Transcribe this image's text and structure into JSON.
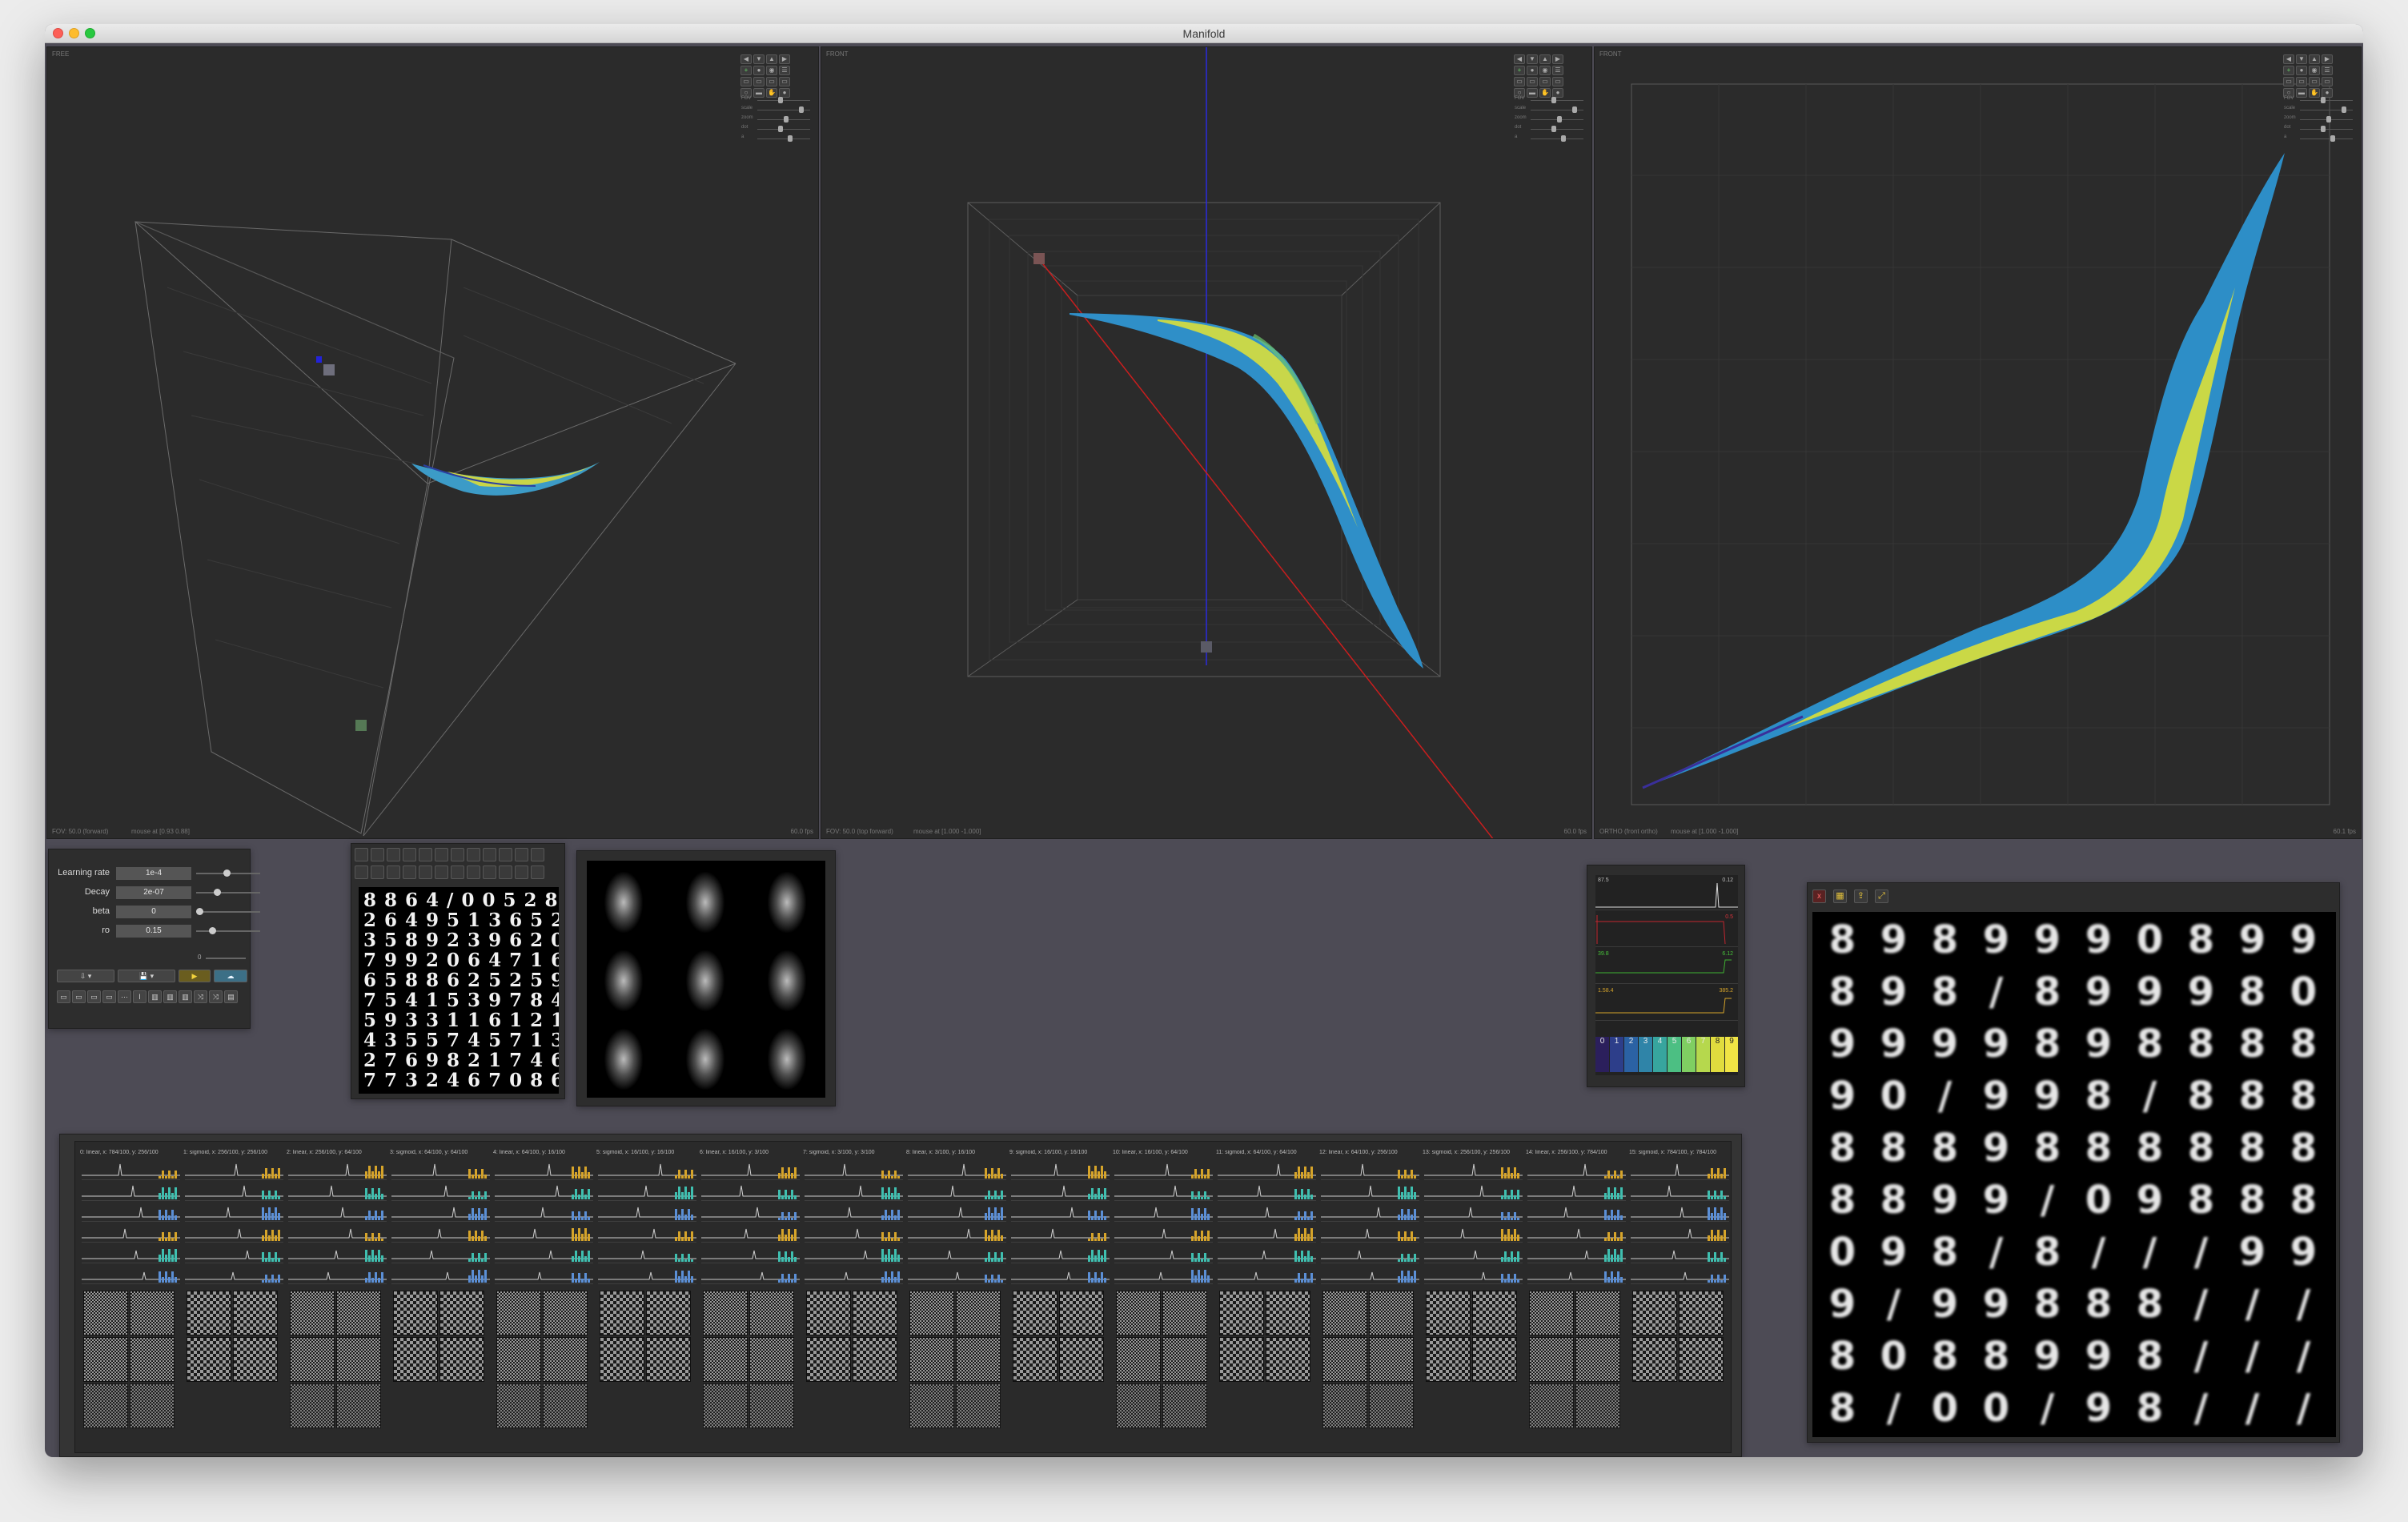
{
  "window": {
    "title": "Manifold"
  },
  "viewports": [
    {
      "id": "perspective",
      "top_label": "FREE",
      "bottom_left": "FOV: 50.0 (forward)",
      "bottom_mid": "mouse at [0.93 0.88]",
      "bottom_right": "60.0 fps"
    },
    {
      "id": "front",
      "top_label": "FRONT",
      "bottom_left": "FOV: 50.0 (top forward)",
      "bottom_mid": "mouse at [1.000 -1.000]",
      "bottom_right": "60.0 fps"
    },
    {
      "id": "ortho",
      "top_label": "FRONT",
      "bottom_left": "ORTHO (front ortho)",
      "bottom_mid": "mouse at [1.000 -1.000]",
      "bottom_right": "60.1 fps"
    }
  ],
  "viewport_controls": {
    "nav_arrows": [
      "◀",
      "▼",
      "▲",
      "▶"
    ],
    "sliders": [
      {
        "label": "FOV",
        "value": 0.45
      },
      {
        "label": "scale",
        "value": 0.8
      },
      {
        "label": "zoom",
        "value": 0.55
      },
      {
        "label": "dot",
        "value": 0.45
      },
      {
        "label": "a",
        "value": 0.6
      }
    ]
  },
  "hyperparams": {
    "rows": [
      {
        "label": "Learning rate",
        "value": "1e-4",
        "slider": 0.45
      },
      {
        "label": "Decay",
        "value": "2e-07",
        "slider": 0.3
      },
      {
        "label": "beta",
        "value": "0",
        "slider": 0.0
      },
      {
        "label": "ro",
        "value": "0.15",
        "slider": 0.2
      }
    ],
    "epoch_value": "0",
    "buttons": {
      "export": "⇩ ▾",
      "save": "💾 ▾",
      "play": "▶",
      "cloud": "☁"
    },
    "toolbar_icons": [
      "▭",
      "▭",
      "▭",
      "▭",
      "⋯",
      "I",
      "▥",
      "▥",
      "▥",
      "⤨",
      "⤨",
      "▤"
    ]
  },
  "data_panel": {
    "digits_text": "8 8 6 4 / 0 0 5 2 8\n2 6 4 9 5 1 3 6 5 2\n3 5 8 9 2 3 9 6 2 0\n7 9 9 2 0 6 4 7 1 6\n6 5 8 8 6 2 5 2 5 9\n7 5 4 1 5 3 9 7 8 4\n5 9 3 3 1 1 6 1 2 1\n4 3 5 5 7 4 5 7 1 3\n2 7 6 9 8 2 1 7 4 6\n7 7 3 2 4 6 7 0 8 6"
  },
  "legend": {
    "classes": [
      "0",
      "1",
      "2",
      "3",
      "4",
      "5",
      "6",
      "7",
      "8",
      "9"
    ],
    "colors": [
      "#2b1f5c",
      "#2d3e8a",
      "#2b62a4",
      "#2f84a8",
      "#37a59e",
      "#4cbf83",
      "#7fcf62",
      "#b6d84d",
      "#e0dc3e",
      "#f0e445"
    ]
  },
  "stats_panel": {
    "rows": [
      {
        "label": "87.5",
        "value": "0.12",
        "color": "#bbbbbb"
      },
      {
        "label": "",
        "value": "0.5",
        "color": "#d9323b"
      },
      {
        "label": "39.8",
        "value": "6.12",
        "color": "#47c03a"
      },
      {
        "label": "1.58.4",
        "value": "385.2",
        "color": "#d6a42a"
      }
    ]
  },
  "reconstruction_panel": {
    "icons": [
      "close-icon",
      "grid-icon",
      "export-icon",
      "fullscreen-icon"
    ],
    "grid": [
      [
        "8",
        "9",
        "8",
        "9",
        "9",
        "9",
        "0",
        "8",
        "9",
        "9"
      ],
      [
        "8",
        "9",
        "8",
        "/",
        "8",
        "9",
        "9",
        "9",
        "8",
        "0"
      ],
      [
        "9",
        "9",
        "9",
        "9",
        "8",
        "9",
        "8",
        "8",
        "8",
        "8"
      ],
      [
        "9",
        "0",
        "/",
        "9",
        "9",
        "8",
        "/",
        "8",
        "8",
        "8"
      ],
      [
        "8",
        "8",
        "8",
        "9",
        "8",
        "8",
        "8",
        "8",
        "8",
        "8"
      ],
      [
        "8",
        "8",
        "9",
        "9",
        "/",
        "0",
        "9",
        "8",
        "8",
        "8"
      ],
      [
        "0",
        "9",
        "8",
        "/",
        "8",
        "/",
        "/",
        "/",
        "9",
        "9"
      ],
      [
        "9",
        "/",
        "9",
        "9",
        "8",
        "8",
        "8",
        "/",
        "/",
        "/"
      ],
      [
        "8",
        "0",
        "8",
        "8",
        "9",
        "9",
        "8",
        "/",
        "/",
        "/"
      ],
      [
        "8",
        "/",
        "0",
        "0",
        "/",
        "9",
        "8",
        "/",
        "/",
        "/"
      ]
    ]
  },
  "layers": [
    {
      "header": "0: linear, x: 784/100, y: 256/100",
      "tiles": 6
    },
    {
      "header": "1: sigmoid, x: 256/100, y: 256/100",
      "tiles": 4
    },
    {
      "header": "2: linear, x: 256/100, y: 64/100",
      "tiles": 6
    },
    {
      "header": "3: sigmoid, x: 64/100, y: 64/100",
      "tiles": 4
    },
    {
      "header": "4: linear, x: 64/100, y: 16/100",
      "tiles": 6
    },
    {
      "header": "5: sigmoid, x: 16/100, y: 16/100",
      "tiles": 4
    },
    {
      "header": "6: linear, x: 16/100, y: 3/100",
      "tiles": 6
    },
    {
      "header": "7: sigmoid, x: 3/100, y: 3/100",
      "tiles": 4
    },
    {
      "header": "8: linear, x: 3/100, y: 16/100",
      "tiles": 6
    },
    {
      "header": "9: sigmoid, x: 16/100, y: 16/100",
      "tiles": 4
    },
    {
      "header": "10: linear, x: 16/100, y: 64/100",
      "tiles": 6
    },
    {
      "header": "11: sigmoid, x: 64/100, y: 64/100",
      "tiles": 4
    },
    {
      "header": "12: linear, x: 64/100, y: 256/100",
      "tiles": 6
    },
    {
      "header": "13: sigmoid, x: 256/100, y: 256/100",
      "tiles": 4
    },
    {
      "header": "14: linear, x: 256/100, y: 784/100",
      "tiles": 6
    },
    {
      "header": "15: sigmoid, x: 784/100, y: 784/100",
      "tiles": 4
    }
  ]
}
